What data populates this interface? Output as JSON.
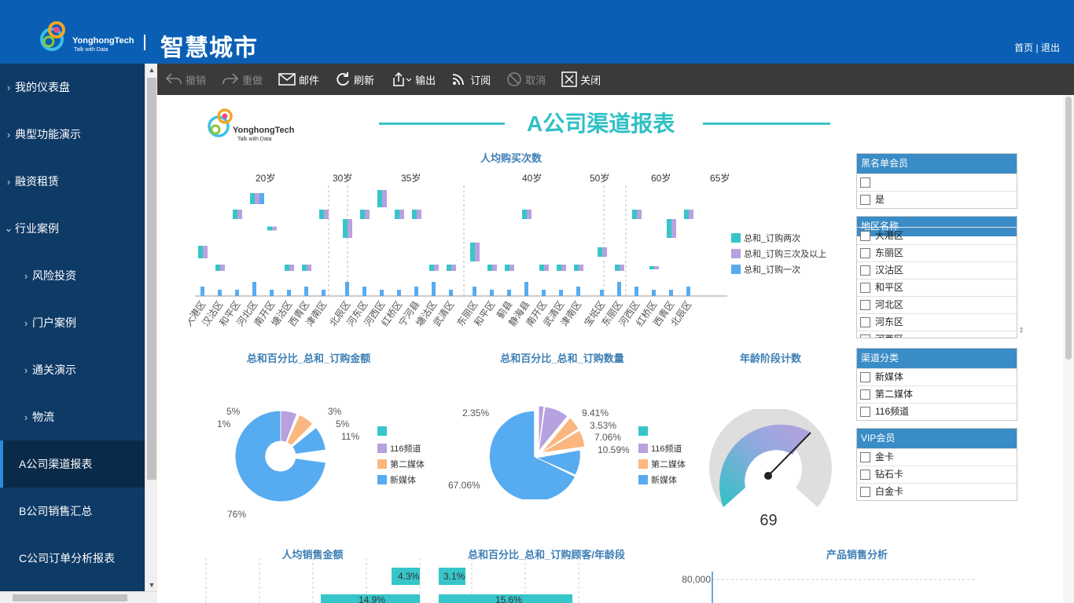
{
  "header": {
    "logo_text": "YonghongTech",
    "logo_sub": "Talk with Data",
    "app_title": "智慧城市",
    "home_link": "首页",
    "sep": " | ",
    "logout_link": "退出"
  },
  "sidebar": {
    "items": [
      {
        "label": "我的仪表盘",
        "expand": "›"
      },
      {
        "label": "典型功能演示",
        "expand": "›"
      },
      {
        "label": "融资租赁",
        "expand": "›"
      },
      {
        "label": "行业案例",
        "expand": "⌄"
      },
      {
        "label": "风险投资",
        "expand": "›"
      },
      {
        "label": "门户案例",
        "expand": "›"
      },
      {
        "label": "通关演示",
        "expand": "›"
      },
      {
        "label": "物流",
        "expand": "›"
      },
      {
        "label": "A公司渠道报表"
      },
      {
        "label": "B公司销售汇总"
      },
      {
        "label": "C公司订单分析报表"
      }
    ]
  },
  "toolbar": {
    "undo": "撤销",
    "redo": "重做",
    "mail": "邮件",
    "refresh": "刷新",
    "export": "输出",
    "subscribe": "订阅",
    "cancel": "取消",
    "close": "关闭"
  },
  "report": {
    "logo_text": "YonghongTech",
    "logo_sub": "Talk with Data",
    "title": "A公司渠道报表"
  },
  "colors": {
    "teal": "#36c5c8",
    "purple": "#b7a1de",
    "blue": "#57abf0",
    "orange": "#fbb77f"
  },
  "chart_data": [
    {
      "type": "bar",
      "title": "人均购买次数",
      "groups": [
        "20岁",
        "30岁",
        "35岁",
        "40岁",
        "50岁",
        "60岁",
        "65岁"
      ],
      "categories": [
        "大港区",
        "汉沽区",
        "和平区",
        "河北区",
        "南开区",
        "塘沽区",
        "西青区",
        "津南区",
        "北辰区",
        "河东区",
        "河西区",
        "红桥区",
        "宁河县",
        "塘沽区",
        "武清区",
        "东丽区",
        "和平区",
        "蓟县",
        "静海县",
        "南开区",
        "武清区",
        "津南区",
        "宝坻区",
        "东丽区",
        "河西区",
        "红桥区",
        "西青区",
        "北辰区"
      ],
      "series": [
        {
          "name": "总和_订购两次"
        },
        {
          "name": "总和_订购三次及以上"
        },
        {
          "name": "总和_订购一次"
        }
      ]
    },
    {
      "type": "pie",
      "title": "总和百分比_总和_订购金额",
      "labels": [
        "5%",
        "1%",
        "3%",
        "5%",
        "11%",
        "76%"
      ],
      "legend": [
        "",
        "116频道",
        "第二媒体",
        "新媒体"
      ]
    },
    {
      "type": "pie",
      "title": "总和百分比_总和_订购数量",
      "labels": [
        "2.35%",
        "9.41%",
        "3.53%",
        "7.06%",
        "10.59%",
        "67.06%"
      ],
      "legend": [
        "",
        "116频道",
        "第二媒体",
        "新媒体"
      ]
    },
    {
      "type": "gauge",
      "title": "年龄阶段计数",
      "value": 69
    },
    {
      "type": "bar",
      "title": "人均销售金额",
      "labels": [
        "4.3%",
        "14.9%"
      ]
    },
    {
      "type": "bar",
      "title": "总和百分比_总和_订购顾客/年龄段",
      "labels": [
        "3.1%",
        "15.6%"
      ]
    },
    {
      "type": "line",
      "title": "产品销售分析",
      "ytick": "80,000"
    }
  ],
  "filters": {
    "blacklist": {
      "title": "黑名单会员",
      "options": [
        "",
        "是"
      ]
    },
    "region": {
      "title": "地区名称",
      "options": [
        "大港区",
        "东丽区",
        "汉沽区",
        "和平区",
        "河北区",
        "河东区",
        "河西区"
      ]
    },
    "channel": {
      "title": "渠道分类",
      "options": [
        "新媒体",
        "第二媒体",
        "116频道"
      ]
    },
    "vip": {
      "title": "VIP会员",
      "options": [
        "金卡",
        "钻石卡",
        "白金卡"
      ]
    }
  }
}
